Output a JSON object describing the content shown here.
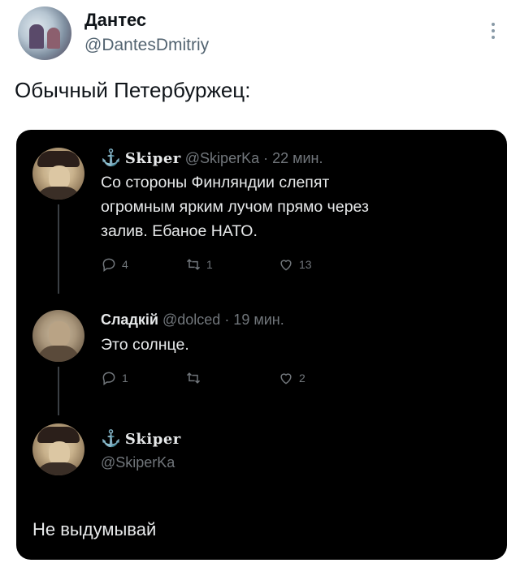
{
  "outer_tweet": {
    "author_name": "Дантес",
    "author_handle": "@DantesDmitriy",
    "text": "Обычный Петербуржец:"
  },
  "quoted_thread": [
    {
      "name_glyph": "⚓",
      "name": "Skiper",
      "handle": "@SkiperKa",
      "time": "· 22 мин.",
      "text_lines": [
        "Со стороны Финляндии слепят",
        "огромным ярким лучом прямо через",
        "залив. Ебаное НАТО."
      ],
      "replies": "4",
      "retweets": "1",
      "likes": "13"
    },
    {
      "name": "Сладкій",
      "handle": "@dolced",
      "time": "· 19 мин.",
      "text_lines": [
        "Это солнце."
      ],
      "replies": "1",
      "retweets": "",
      "likes": "2"
    },
    {
      "name_glyph": "⚓",
      "name": "Skiper",
      "handle": "@SkiperKa",
      "text": "Не выдумывай"
    }
  ],
  "icons": [
    "more-vertical-icon",
    "reply-icon",
    "retweet-icon",
    "like-icon"
  ],
  "colors": {
    "card_bg": "#000000",
    "muted": "#71767b",
    "text_light": "#e7e9ea",
    "handle_gray": "#536471"
  }
}
